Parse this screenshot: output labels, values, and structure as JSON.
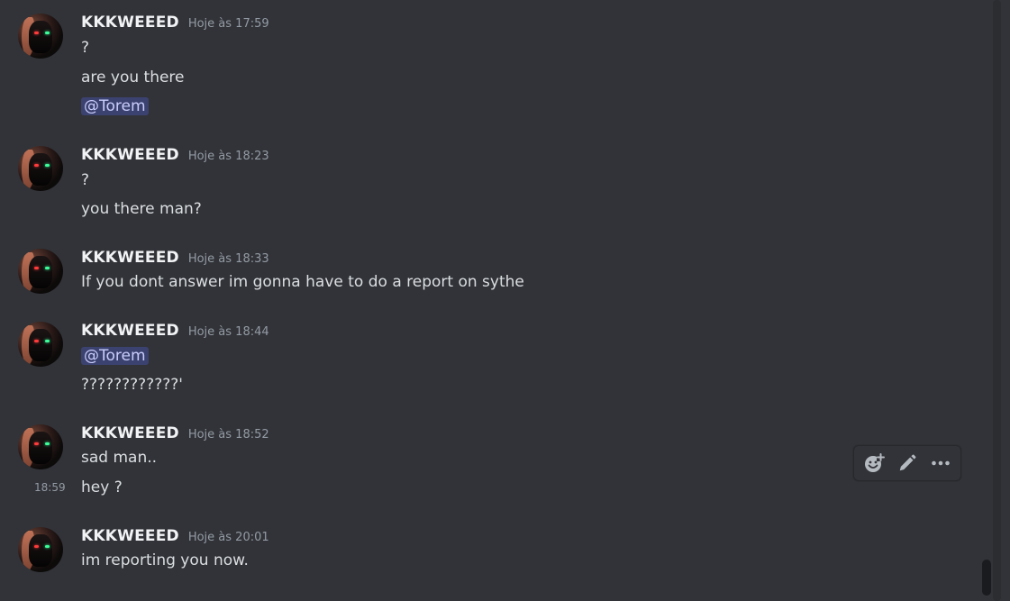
{
  "messages": [
    {
      "username": "KKKWEEED",
      "time": "Hoje às 17:59",
      "lines": [
        {
          "text": "?"
        },
        {
          "text": "are you there"
        },
        {
          "mention": "@Torem"
        }
      ]
    },
    {
      "username": "KKKWEEED",
      "time": "Hoje às 18:23",
      "lines": [
        {
          "text": "?"
        },
        {
          "text": "you there man?"
        }
      ]
    },
    {
      "username": "KKKWEEED",
      "time": "Hoje às 18:33",
      "lines": [
        {
          "text": "If you dont answer im gonna have to do a report on sythe"
        }
      ]
    },
    {
      "username": "KKKWEEED",
      "time": "Hoje às 18:44",
      "lines": [
        {
          "mention": "@Torem"
        },
        {
          "text": "????????????'"
        }
      ]
    },
    {
      "username": "KKKWEEED",
      "time": "Hoje às 18:52",
      "lines": [
        {
          "text": "sad man.."
        },
        {
          "text": "hey ?",
          "side_time": "18:59"
        }
      ]
    },
    {
      "username": "KKKWEEED",
      "time": "Hoje às 20:01",
      "lines": [
        {
          "text": "im reporting you now."
        }
      ]
    }
  ],
  "toolbar": {
    "icons": [
      "add-reaction-icon",
      "edit-pencil-icon",
      "more-options-icon"
    ]
  },
  "colors": {
    "background": "#313338",
    "mention_bg": "#3c4270",
    "mention_text": "#c9cdfb",
    "username": "#f2f3f5",
    "timestamp": "#949ba4"
  }
}
